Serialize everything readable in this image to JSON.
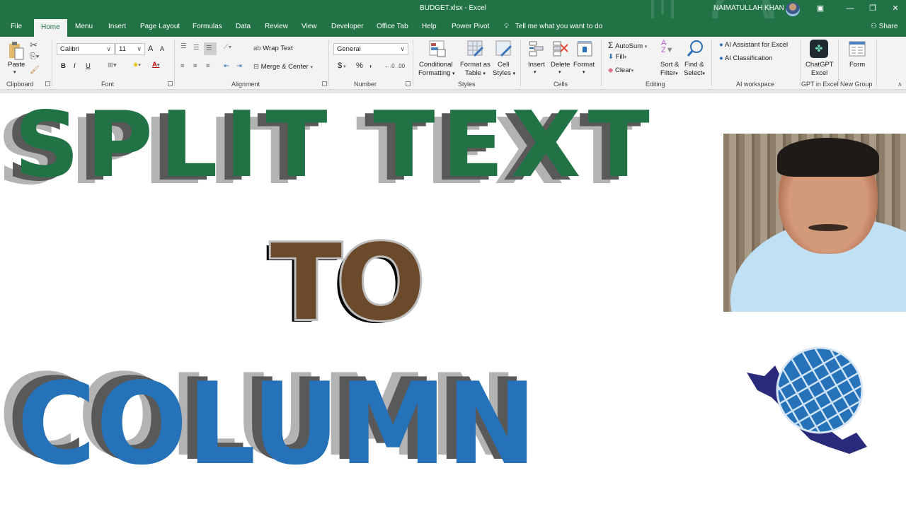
{
  "window": {
    "title": "BUDGET.xlsx  -  Excel",
    "user_name": "NAIMATULLAH KHAN",
    "controls": {
      "ribbon_display": "▣",
      "minimize": "—",
      "restore": "❐",
      "close": "✕"
    }
  },
  "tabs": [
    {
      "label": "File"
    },
    {
      "label": "Home",
      "active": true
    },
    {
      "label": "Menu"
    },
    {
      "label": "Insert"
    },
    {
      "label": "Page Layout"
    },
    {
      "label": "Formulas"
    },
    {
      "label": "Data"
    },
    {
      "label": "Review"
    },
    {
      "label": "View"
    },
    {
      "label": "Developer"
    },
    {
      "label": "Office Tab"
    },
    {
      "label": "Help"
    },
    {
      "label": "Power Pivot"
    }
  ],
  "tell_me": {
    "icon": "lightbulb-icon",
    "placeholder": "Tell me what you want to do"
  },
  "share": {
    "label": "Share",
    "icon": "person-icon"
  },
  "ribbon": {
    "clipboard": {
      "label": "Clipboard",
      "paste": "Paste"
    },
    "font": {
      "label": "Font",
      "font_name": "Calibri",
      "font_size": "11",
      "bold": "B",
      "italic": "I",
      "underline": "U",
      "grow": "A",
      "shrink": "A"
    },
    "alignment": {
      "label": "Alignment",
      "wrap_text": "Wrap Text",
      "merge_center": "Merge & Center"
    },
    "number": {
      "label": "Number",
      "format": "General",
      "currency": "$",
      "percent": "%",
      "comma": ","
    },
    "styles": {
      "label": "Styles",
      "conditional": [
        "Conditional",
        "Formatting"
      ],
      "format_table": [
        "Format as",
        "Table"
      ],
      "cell_styles": [
        "Cell",
        "Styles"
      ]
    },
    "cells": {
      "label": "Cells",
      "insert": "Insert",
      "delete": "Delete",
      "format": "Format"
    },
    "editing": {
      "label": "Editing",
      "autosum": "AutoSum",
      "fill": "Fill",
      "clear": "Clear",
      "sort_filter": [
        "Sort &",
        "Filter"
      ],
      "find_select": [
        "Find &",
        "Select"
      ]
    },
    "ai_workspace": {
      "label": "AI workspace",
      "assistant": "AI Assistant for Excel",
      "classification": "AI Classification"
    },
    "gpt": {
      "label": "GPT in Excel",
      "button": [
        "ChatGPT",
        "Excel"
      ]
    },
    "new_group": {
      "label": "New Group",
      "form": "Form"
    }
  },
  "banner": {
    "line1": "SPLIT TEXT",
    "line2": "TO",
    "line3": "COLUMN",
    "colors": {
      "line1": "#217346",
      "line2": "#6b4a2b",
      "line3": "#2672b8",
      "shadow_light": "#b3b3b3",
      "shadow_dark": "#595959"
    }
  }
}
